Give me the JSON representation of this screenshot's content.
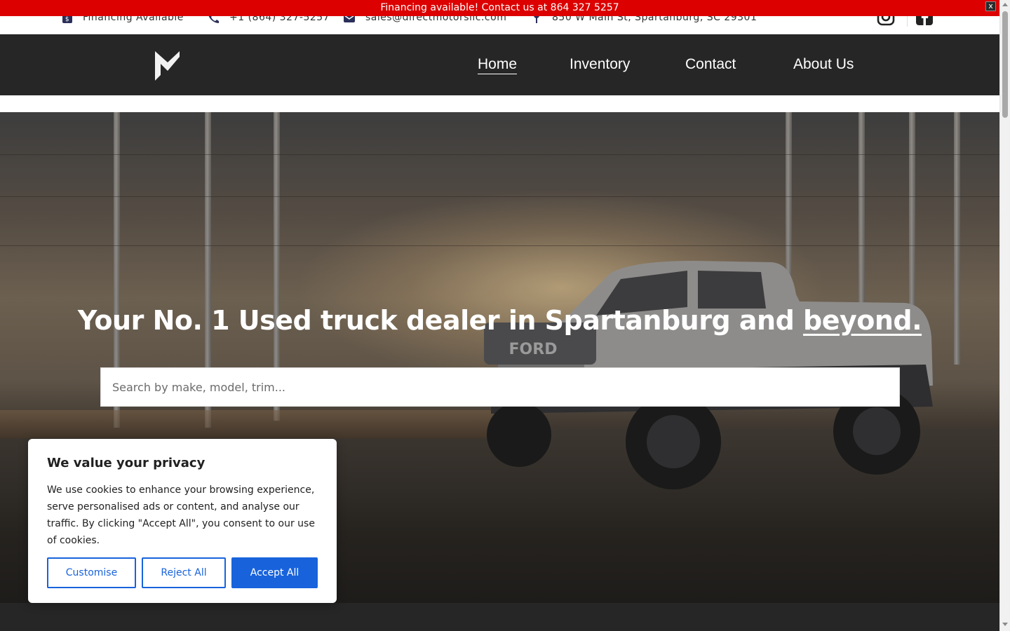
{
  "announcement": {
    "text": "Financing available! Contact us at 864 327 5257",
    "close_label": "x"
  },
  "topbar": {
    "financing": "Financing Available",
    "phone": "+1 (864) 327-5257",
    "email": "sales@directmotorsllc.com",
    "address": "850 W Main St, Spartanburg, SC 29301",
    "icons": [
      "dollar-tag-icon",
      "phone-icon",
      "mail-icon",
      "map-pin-icon",
      "instagram-icon",
      "facebook-icon"
    ]
  },
  "nav": {
    "logo": "direct-motors-logo",
    "links": [
      "Home",
      "Inventory",
      "Contact",
      "About Us"
    ],
    "active": "Home"
  },
  "hero": {
    "title_main": "Your No. 1 Used truck dealer in Spartanburg and ",
    "title_emphasis": "beyond.",
    "search_placeholder": "Search by make, model, trim..."
  },
  "cookie": {
    "title": "We value your privacy",
    "body": "We use cookies to enhance your browsing experience, serve personalised ads or content, and analyse our traffic. By clicking \"Accept All\", you consent to our use of cookies.",
    "customise": "Customise",
    "reject": "Reject All",
    "accept": "Accept All"
  },
  "colors": {
    "announcement_bg": "#dc0000",
    "nav_bg": "#262626",
    "cookie_accent": "#1863dc"
  }
}
